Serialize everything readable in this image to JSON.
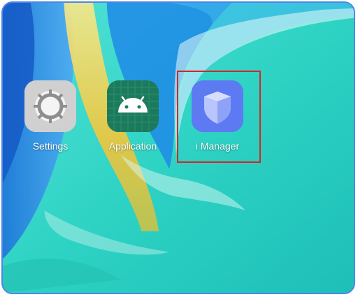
{
  "home_screen": {
    "apps": [
      {
        "label": "Settings",
        "icon": "gear-icon",
        "tile_color": "#c9c9c9"
      },
      {
        "label": "Application",
        "icon": "android-icon",
        "tile_color": "#1c7a5c"
      },
      {
        "label": "i Manager",
        "icon": "shield-icon",
        "tile_color": "#5d7af2"
      }
    ],
    "highlight_color": "#d42626"
  }
}
